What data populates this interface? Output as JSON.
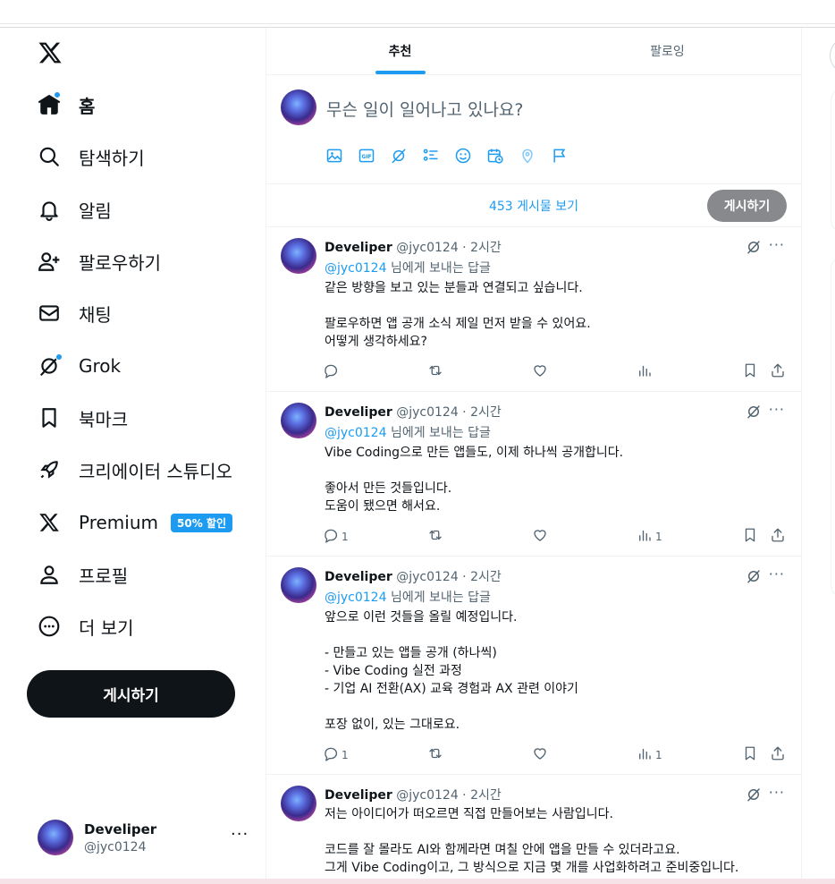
{
  "sidebar": {
    "nav": [
      {
        "id": "home",
        "label": "홈",
        "icon": "home-icon",
        "active": true,
        "dot": true
      },
      {
        "id": "explore",
        "label": "탐색하기",
        "icon": "search-icon"
      },
      {
        "id": "notifications",
        "label": "알림",
        "icon": "bell-icon"
      },
      {
        "id": "follow",
        "label": "팔로우하기",
        "icon": "person-add-icon"
      },
      {
        "id": "chat",
        "label": "채팅",
        "icon": "mail-icon"
      },
      {
        "id": "grok",
        "label": "Grok",
        "icon": "grok-icon",
        "dot": true
      },
      {
        "id": "bookmarks",
        "label": "북마크",
        "icon": "bookmark-icon"
      },
      {
        "id": "creator-studio",
        "label": "크리에이터 스튜디오",
        "icon": "rocket-icon"
      },
      {
        "id": "premium",
        "label": "Premium",
        "icon": "x-logo-icon",
        "badge": "50% 할인"
      },
      {
        "id": "profile",
        "label": "프로필",
        "icon": "person-icon"
      },
      {
        "id": "more",
        "label": "더 보기",
        "icon": "more-circle-icon"
      }
    ],
    "post_button": "게시하기",
    "account": {
      "name": "Develiper",
      "handle": "@jyc0124",
      "more": "···"
    }
  },
  "main": {
    "tabs": [
      {
        "label": "추천",
        "active": true
      },
      {
        "label": "팔로잉",
        "active": false
      }
    ],
    "composer": {
      "placeholder": "무슨 일이 일어나고 있나요?",
      "post_label": "게시하기",
      "tools": [
        "image-icon",
        "gif-icon",
        "grok-icon",
        "poll-icon",
        "emoji-icon",
        "schedule-icon",
        "location-icon",
        "flag-icon"
      ]
    },
    "show_posts": "453 게시물 보기",
    "tweets": [
      {
        "name": "Develiper",
        "meta": "@jyc0124 · 2시간",
        "reply_handle": "@jyc0124",
        "reply_suffix": " 님에게 보내는 답글",
        "body": "같은 방향을 보고 있는 분들과 연결되고 싶습니다.\n\n팔로우하면 앱 공개 소식 제일 먼저 받을 수 있어요.\n어떻게 생각하세요?",
        "replies": "",
        "views": ""
      },
      {
        "name": "Develiper",
        "meta": "@jyc0124 · 2시간",
        "reply_handle": "@jyc0124",
        "reply_suffix": " 님에게 보내는 답글",
        "body": "Vibe Coding으로 만든 앱들도, 이제 하나씩 공개합니다.\n\n좋아서 만든 것들입니다.\n도움이 됐으면 해서요.",
        "replies": "1",
        "views": "1"
      },
      {
        "name": "Develiper",
        "meta": "@jyc0124 · 2시간",
        "reply_handle": "@jyc0124",
        "reply_suffix": " 님에게 보내는 답글",
        "body": "앞으로 이런 것들을 올릴 예정입니다.\n\n- 만들고 있는 앱들 공개 (하나씩)\n- Vibe Coding 실전 과정\n- 기업 AI 전환(AX) 교육 경험과 AX 관련 이야기\n\n포장 없이, 있는 그대로요.",
        "replies": "1",
        "views": "1"
      },
      {
        "name": "Develiper",
        "meta": "@jyc0124 · 2시간",
        "body": "저는 아이디어가 떠오르면 직접 만들어보는 사람입니다.\n\n코드를 잘 몰라도 AI와 함께라면 며칠 안에 앱을 만들 수 있더라고요.\n그게 Vibe Coding이고, 그 방식으로 지금 몇 개를 사업화하려고 준비중입니다."
      }
    ]
  },
  "colors": {
    "accent": "#1d9bf0",
    "text": "#0f1419",
    "muted": "#536471",
    "post_button_bg": "#0f1419",
    "composer_post_bg": "#87898c"
  }
}
